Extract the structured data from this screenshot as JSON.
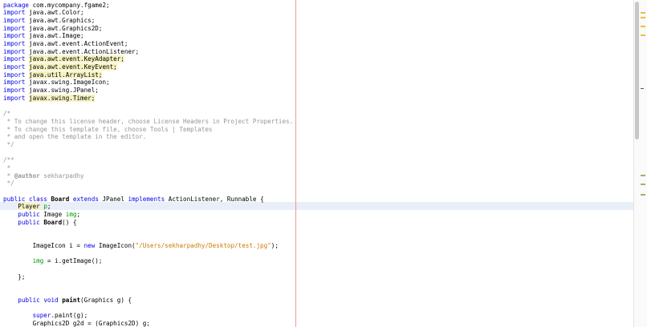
{
  "editor": {
    "lines": [
      [
        {
          "t": "package",
          "c": "kw"
        },
        {
          "t": " com.mycompany.fgame2;"
        }
      ],
      [
        {
          "t": "import",
          "c": "kw"
        },
        {
          "t": " java.awt.Color;"
        }
      ],
      [
        {
          "t": "import",
          "c": "kw"
        },
        {
          "t": " java.awt.Graphics;"
        }
      ],
      [
        {
          "t": "import",
          "c": "kw"
        },
        {
          "t": " java.awt.Graphics2D;"
        }
      ],
      [
        {
          "t": "import",
          "c": "kw"
        },
        {
          "t": " java.awt.Image;"
        }
      ],
      [
        {
          "t": "import",
          "c": "kw"
        },
        {
          "t": " java.awt.event.ActionEvent;"
        }
      ],
      [
        {
          "t": "import",
          "c": "kw"
        },
        {
          "t": " java.awt.event.ActionListener;"
        }
      ],
      [
        {
          "t": "import",
          "c": "kw"
        },
        {
          "t": " "
        },
        {
          "t": "java.awt.event.KeyAdapter;",
          "c": "hl"
        }
      ],
      [
        {
          "t": "import",
          "c": "kw"
        },
        {
          "t": " "
        },
        {
          "t": "java.awt.event.KeyEvent;",
          "c": "hl"
        }
      ],
      [
        {
          "t": "import",
          "c": "kw"
        },
        {
          "t": " "
        },
        {
          "t": "java.util.ArrayList;",
          "c": "hl"
        }
      ],
      [
        {
          "t": "import",
          "c": "kw"
        },
        {
          "t": " javax.swing.ImageIcon;"
        }
      ],
      [
        {
          "t": "import",
          "c": "kw"
        },
        {
          "t": " javax.swing.JPanel;"
        }
      ],
      [
        {
          "t": "import",
          "c": "kw"
        },
        {
          "t": " "
        },
        {
          "t": "javax.swing.Timer;",
          "c": "hl"
        }
      ],
      [],
      [
        {
          "t": "/*",
          "c": "com"
        }
      ],
      [
        {
          "t": " * To change this license header, choose License Headers in Project Properties.",
          "c": "com"
        }
      ],
      [
        {
          "t": " * To change this template file, choose Tools | Templates",
          "c": "com"
        }
      ],
      [
        {
          "t": " * and open the template in the editor.",
          "c": "com"
        }
      ],
      [
        {
          "t": " */",
          "c": "com"
        }
      ],
      [],
      [
        {
          "t": "/**",
          "c": "com"
        }
      ],
      [
        {
          "t": " *",
          "c": "com"
        }
      ],
      [
        {
          "t": " * ",
          "c": "com"
        },
        {
          "t": "@author",
          "c": "com bold"
        },
        {
          "t": " sekharpadhy",
          "c": "com"
        }
      ],
      [
        {
          "t": " */",
          "c": "com"
        }
      ],
      [],
      [
        {
          "t": "public",
          "c": "kw"
        },
        {
          "t": " "
        },
        {
          "t": "class",
          "c": "kw"
        },
        {
          "t": " "
        },
        {
          "t": "Board",
          "c": "bold"
        },
        {
          "t": " "
        },
        {
          "t": "extends",
          "c": "kw"
        },
        {
          "t": " JPanel "
        },
        {
          "t": "implements",
          "c": "kw"
        },
        {
          "t": " ActionListener, Runnable {"
        }
      ],
      [
        {
          "t": "    "
        },
        {
          "t": "Player",
          "c": "hl"
        },
        {
          "t": " "
        },
        {
          "t": "p",
          "c": "fld"
        },
        {
          "t": ";"
        }
      ],
      [
        {
          "t": "    "
        },
        {
          "t": "public",
          "c": "kw"
        },
        {
          "t": " Image "
        },
        {
          "t": "img",
          "c": "fld"
        },
        {
          "t": ";"
        }
      ],
      [
        {
          "t": "    "
        },
        {
          "t": "public",
          "c": "kw"
        },
        {
          "t": " "
        },
        {
          "t": "Board",
          "c": "bold"
        },
        {
          "t": "() {"
        }
      ],
      [],
      [],
      [
        {
          "t": "        ImageIcon i = "
        },
        {
          "t": "new",
          "c": "kw"
        },
        {
          "t": " ImageIcon("
        },
        {
          "t": "\"/Users/sekharpadhy/Desktop/test.jpg\"",
          "c": "str"
        },
        {
          "t": ");"
        }
      ],
      [],
      [
        {
          "t": "        "
        },
        {
          "t": "img",
          "c": "fld"
        },
        {
          "t": " = i.getImage();"
        }
      ],
      [],
      [
        {
          "t": "    };"
        }
      ],
      [],
      [],
      [
        {
          "t": "    "
        },
        {
          "t": "public",
          "c": "kw"
        },
        {
          "t": " "
        },
        {
          "t": "void",
          "c": "kw"
        },
        {
          "t": " "
        },
        {
          "t": "paint",
          "c": "bold"
        },
        {
          "t": "(Graphics g) {"
        }
      ],
      [],
      [
        {
          "t": "        "
        },
        {
          "t": "super",
          "c": "kw"
        },
        {
          "t": ".paint(g);"
        }
      ],
      [
        {
          "t": "        Graphics2D g2d = (Graphics2D) g;"
        }
      ]
    ],
    "colors": {
      "keyword": "#0000e6",
      "string": "#ce7b00",
      "comment": "#969696",
      "field": "#009900",
      "highlight": "#f6f3c3",
      "current_line": "#e9eff8",
      "right_margin": "#e89a9a"
    }
  },
  "scrollbar": {
    "markers": [
      {
        "color": "yellow"
      },
      {
        "color": "yellow"
      },
      {
        "color": "yellow"
      },
      {
        "color": "yellow"
      },
      {
        "color": "green"
      },
      {
        "color": "green"
      },
      {
        "color": "green"
      }
    ]
  }
}
